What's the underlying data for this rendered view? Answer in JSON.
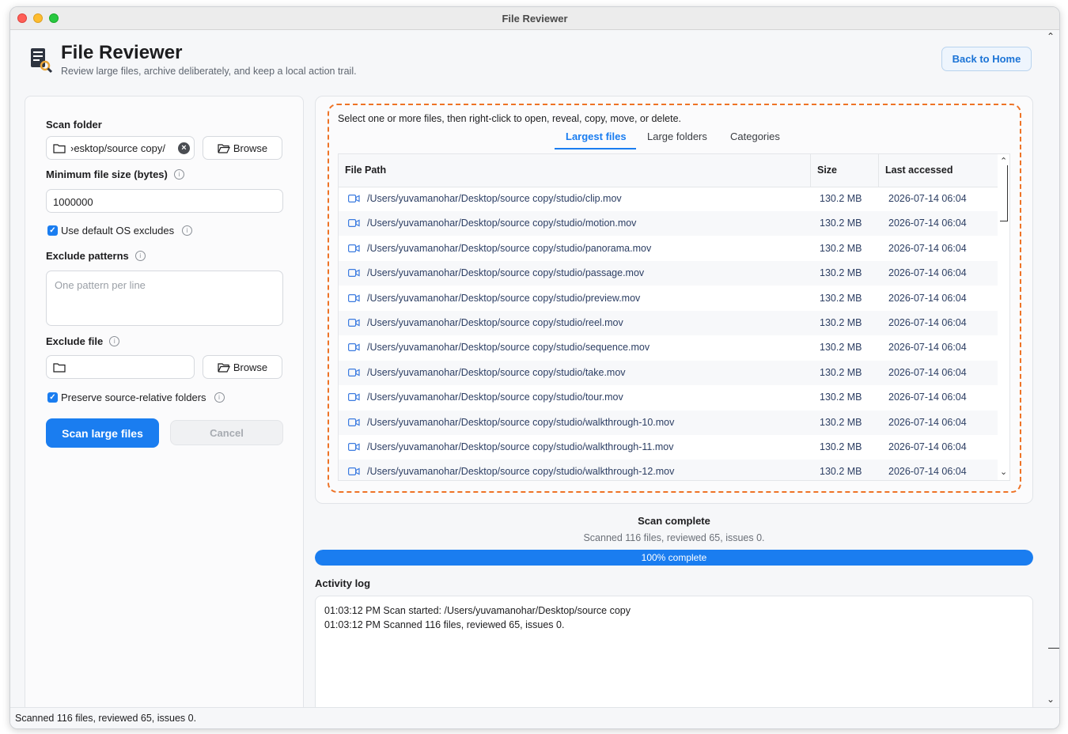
{
  "window": {
    "title": "File Reviewer"
  },
  "header": {
    "title": "File Reviewer",
    "subtitle": "Review large files, archive deliberately, and keep a local action trail.",
    "back_home_label": "Back to Home"
  },
  "form": {
    "scan_folder_label": "Scan folder",
    "scan_folder_value": "›esktop/source copy/",
    "browse_label": "Browse",
    "min_size_label": "Minimum file size (bytes)",
    "min_size_value": "1000000",
    "use_default_excludes_label": "Use default OS excludes",
    "exclude_patterns_label": "Exclude patterns",
    "exclude_patterns_placeholder": "One pattern per line",
    "exclude_file_label": "Exclude file",
    "exclude_file_value": "",
    "preserve_label": "Preserve source-relative folders",
    "scan_button": "Scan large files",
    "cancel_button": "Cancel"
  },
  "results": {
    "hint": "Select one or more files, then right-click to open, reveal, copy, move, or delete.",
    "tabs": [
      {
        "label": "Largest files",
        "active": true
      },
      {
        "label": "Large folders",
        "active": false
      },
      {
        "label": "Categories",
        "active": false
      }
    ],
    "columns": {
      "path": "File Path",
      "size": "Size",
      "accessed": "Last accessed"
    },
    "rows": [
      {
        "path": "/Users/yuvamanohar/Desktop/source copy/studio/clip.mov",
        "size": "130.2 MB",
        "accessed": "2026-07-14 06:04"
      },
      {
        "path": "/Users/yuvamanohar/Desktop/source copy/studio/motion.mov",
        "size": "130.2 MB",
        "accessed": "2026-07-14 06:04"
      },
      {
        "path": "/Users/yuvamanohar/Desktop/source copy/studio/panorama.mov",
        "size": "130.2 MB",
        "accessed": "2026-07-14 06:04"
      },
      {
        "path": "/Users/yuvamanohar/Desktop/source copy/studio/passage.mov",
        "size": "130.2 MB",
        "accessed": "2026-07-14 06:04"
      },
      {
        "path": "/Users/yuvamanohar/Desktop/source copy/studio/preview.mov",
        "size": "130.2 MB",
        "accessed": "2026-07-14 06:04"
      },
      {
        "path": "/Users/yuvamanohar/Desktop/source copy/studio/reel.mov",
        "size": "130.2 MB",
        "accessed": "2026-07-14 06:04"
      },
      {
        "path": "/Users/yuvamanohar/Desktop/source copy/studio/sequence.mov",
        "size": "130.2 MB",
        "accessed": "2026-07-14 06:04"
      },
      {
        "path": "/Users/yuvamanohar/Desktop/source copy/studio/take.mov",
        "size": "130.2 MB",
        "accessed": "2026-07-14 06:04"
      },
      {
        "path": "/Users/yuvamanohar/Desktop/source copy/studio/tour.mov",
        "size": "130.2 MB",
        "accessed": "2026-07-14 06:04"
      },
      {
        "path": "/Users/yuvamanohar/Desktop/source copy/studio/walkthrough-10.mov",
        "size": "130.2 MB",
        "accessed": "2026-07-14 06:04"
      },
      {
        "path": "/Users/yuvamanohar/Desktop/source copy/studio/walkthrough-11.mov",
        "size": "130.2 MB",
        "accessed": "2026-07-14 06:04"
      },
      {
        "path": "/Users/yuvamanohar/Desktop/source copy/studio/walkthrough-12.mov",
        "size": "130.2 MB",
        "accessed": "2026-07-14 06:04"
      }
    ]
  },
  "status": {
    "title": "Scan complete",
    "detail": "Scanned 116 files, reviewed 65, issues 0.",
    "progress_label": "100% complete",
    "progress_fraction": 1.0
  },
  "log": {
    "label": "Activity log",
    "lines": [
      "01:03:12 PM  Scan started: /Users/yuvamanohar/Desktop/source copy",
      "01:03:12 PM  Scanned 116 files, reviewed 65, issues 0."
    ]
  },
  "statusbar": {
    "text": "Scanned 116 files, reviewed 65, issues 0."
  },
  "colors": {
    "accent": "#1a7df0",
    "highlight": "#ee7326"
  },
  "icons": [
    "folder-icon",
    "clear-icon",
    "info-icon",
    "video-icon",
    "app-logo-icon"
  ]
}
